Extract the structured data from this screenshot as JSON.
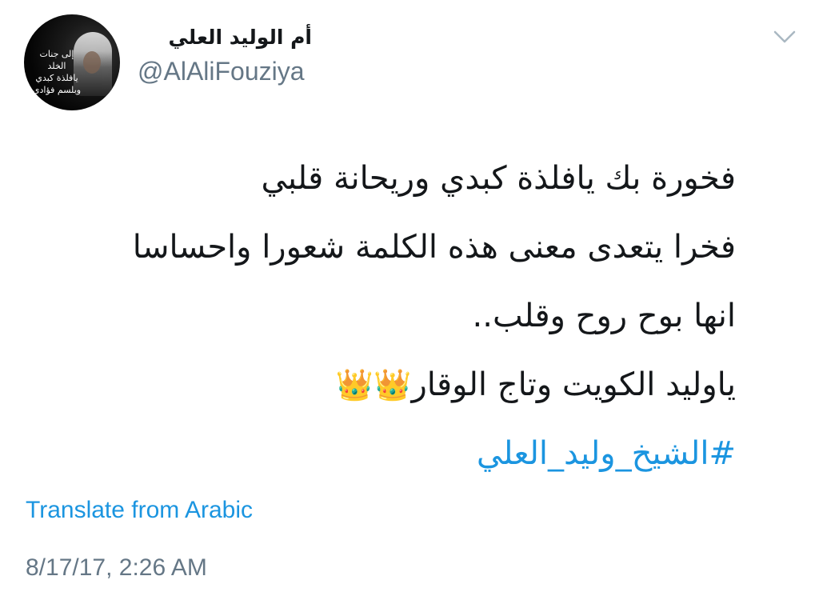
{
  "user": {
    "display_name": "أم الوليد العلي",
    "handle": "@AlAliFouziya",
    "avatar_text": [
      "إلى جنات الخلد",
      "يافلذة كبدي",
      "وبلسم فؤادي"
    ]
  },
  "tweet": {
    "lines": [
      "فخورة بك يافلذة كبدي وريحانة قلبي",
      "فخرا يتعدى معنى هذه الكلمة شعورا واحساسا",
      "انها بوح روح وقلب..",
      "ياوليد الكويت وتاج الوقار"
    ],
    "crown_emoji": "👑👑",
    "hashtag": "#الشيخ_وليد_العلي"
  },
  "actions": {
    "translate_label": "Translate from Arabic",
    "menu_icon": "chevron-down-icon"
  },
  "meta": {
    "timestamp": "8/17/17, 2:26 AM"
  },
  "colors": {
    "link": "#1b95e0",
    "muted": "#657786",
    "text": "#14171a"
  }
}
